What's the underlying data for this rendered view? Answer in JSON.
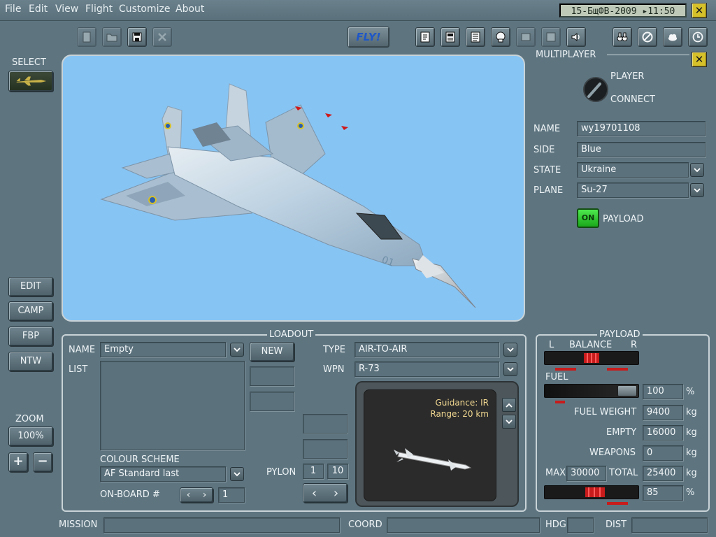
{
  "menu": [
    "File",
    "Edit",
    "View",
    "Flight",
    "Customize",
    "About"
  ],
  "clock": "15-БщФВ-2009 ▸11:50",
  "toolbar": {
    "fly_label": "FLY!",
    "left_icons": [
      "new-icon",
      "open-icon",
      "save-icon",
      "delete-icon"
    ],
    "right_icons": [
      "summary-icon",
      "briefing-icon",
      "checklist-icon",
      "pilot-icon",
      "radio-icon",
      "book-icon",
      "sound-icon",
      "binoculars-icon",
      "no-icon",
      "weather-icon",
      "clock-icon"
    ]
  },
  "select": {
    "label": "SELECT"
  },
  "side_buttons": [
    "EDIT",
    "CAMP",
    "FBP",
    "NTW"
  ],
  "zoom": {
    "label": "ZOOM",
    "value": "100%",
    "plus": "+",
    "minus": "−"
  },
  "multiplayer": {
    "title": "MULTIPLAYER",
    "player": "PLAYER",
    "connect": "CONNECT",
    "name_label": "NAME",
    "name_value": "wy19701108",
    "side_label": "SIDE",
    "side_value": "Blue",
    "state_label": "STATE",
    "state_value": "Ukraine",
    "plane_label": "PLANE",
    "plane_value": "Su-27",
    "on_label": "ON",
    "payload_label": "PAYLOAD"
  },
  "loadout": {
    "title": "LOADOUT",
    "name_label": "NAME",
    "name_value": "Empty",
    "new_button": "NEW",
    "list_label": "LIST",
    "colour_label": "COLOUR SCHEME",
    "colour_value": "AF Standard last",
    "onboard_label": "ON-BOARD #",
    "onboard_value": "1",
    "type_label": "TYPE",
    "type_value": "AIR-TO-AIR",
    "wpn_label": "WPN",
    "wpn_value": "R-73",
    "pylon_label": "PYLON",
    "pylon_a": "1",
    "pylon_b": "10",
    "guidance": "Guidance: IR",
    "range": "Range: 20 km"
  },
  "payload": {
    "title": "PAYLOAD",
    "l": "L",
    "balance": "BALANCE",
    "r": "R",
    "fuel_label": "FUEL",
    "fuel_value": "100",
    "fuel_unit": "%",
    "fuel_weight_label": "FUEL WEIGHT",
    "fuel_weight_value": "9400",
    "fuel_weight_unit": "kg",
    "empty_label": "EMPTY",
    "empty_value": "16000",
    "empty_unit": "kg",
    "weapons_label": "WEAPONS",
    "weapons_value": "0",
    "weapons_unit": "kg",
    "max_label": "MAX",
    "max_value": "30000",
    "total_label": "TOTAL",
    "total_value": "25400",
    "total_unit": "kg",
    "load_value": "85",
    "load_unit": "%"
  },
  "status": {
    "mission_label": "MISSION",
    "mission_value": "",
    "coord_label": "COORD",
    "coord_value": "",
    "hdg_label": "HDG",
    "hdg_value": "",
    "dist_label": "DIST",
    "dist_value": ""
  },
  "colors": {
    "sky": "#86c4f4",
    "panel": "#5e7580",
    "fly": "#1e57c8",
    "led": "#2bd22b"
  }
}
